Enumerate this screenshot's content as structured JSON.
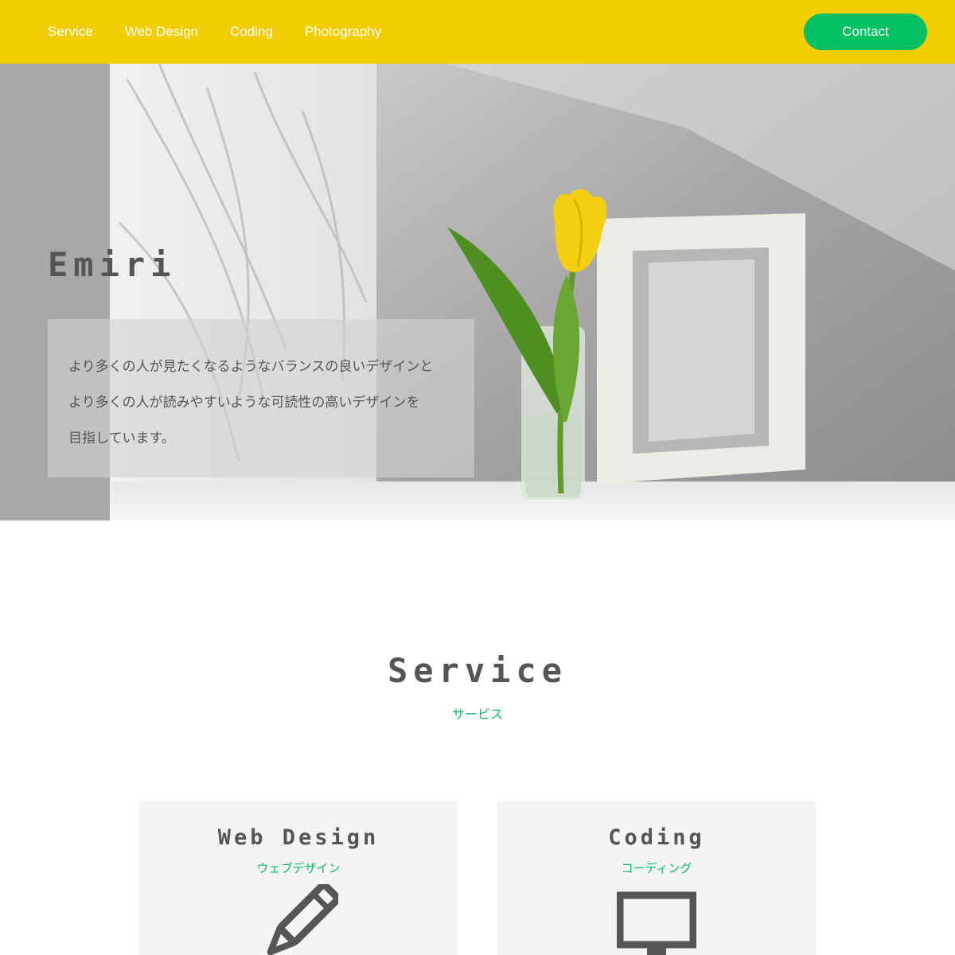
{
  "header": {
    "nav": [
      {
        "label": "Service"
      },
      {
        "label": "Web Design"
      },
      {
        "label": "Coding"
      },
      {
        "label": "Photography"
      }
    ],
    "contact_label": "Contact",
    "background": "#f3cd03",
    "accent": "#05bf63"
  },
  "hero": {
    "title": "Emiri",
    "lines": [
      "より多くの人が見たくなるようなバランスの良いデザインと",
      "より多くの人が読みやすいような可読性の高いデザインを",
      "目指しています。"
    ],
    "image": "tulip-and-frame-photo"
  },
  "service": {
    "title": "Service",
    "subtitle": "サービス",
    "cards": [
      {
        "title": "Web Design",
        "subtitle": "ウェブデザイン",
        "icon": "pencil-icon"
      },
      {
        "title": "Coding",
        "subtitle": "コーディング",
        "icon": "monitor-icon"
      }
    ]
  }
}
